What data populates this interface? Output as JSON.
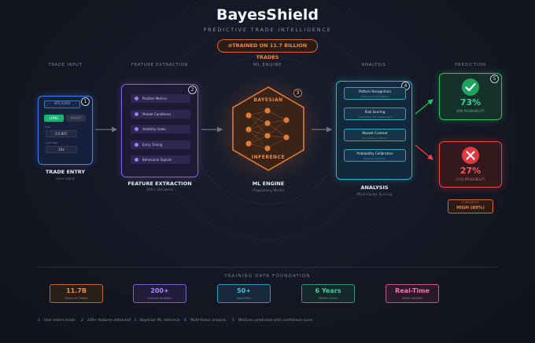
{
  "header": {
    "title": "BayesShield",
    "subtitle": "PREDICTIVE TRADE INTELLIGENCE",
    "badge": "⊚TRAINED ON 11.7 BILLION TRADES"
  },
  "stages": {
    "input": "TRADE INPUT",
    "features": "FEATURE EXTRACTION",
    "engine": "ML ENGINE",
    "analysis": "ANALYSIS",
    "prediction": "PREDICTION"
  },
  "trade": {
    "num": "1",
    "asset": "BTC/USD",
    "long": "LONG",
    "short": "SHORT",
    "size_label": "Size",
    "size": "0.5 BTC",
    "leverage_label": "Leverage",
    "leverage": "10x",
    "title": "TRADE ENTRY",
    "sub": "User Input"
  },
  "features": {
    "num": "2",
    "items": [
      "Position Metrics",
      "Market Conditions",
      "Volatility Index",
      "Entry Timing",
      "Behavioral Signals"
    ],
    "title": "FEATURE EXTRACTION",
    "sub": "200+ Variables"
  },
  "engine": {
    "num": "3",
    "top": "BAYESIAN",
    "bottom": "INFERENCE",
    "title": "ML ENGINE",
    "sub": "Proprietary Model"
  },
  "analysis": {
    "num": "4",
    "items": [
      {
        "title": "Pattern Recognition",
        "sub": "Historical trade patterns"
      },
      {
        "title": "Risk Scoring",
        "sub": "Multi-factor risk assessment"
      },
      {
        "title": "Market Context",
        "sub": "Real-time conditions"
      },
      {
        "title": "Probability Calibration",
        "sub": "Bayesian posterior"
      }
    ],
    "title": "ANALYSIS",
    "sub": "Multi-Factor Scoring"
  },
  "prediction": {
    "num": "5",
    "win_pct": "73%",
    "win_label": "WIN PROBABILITY",
    "loss_pct": "27%",
    "loss_label": "LOSS PROBABILITY",
    "confidence_label": "CONFIDENCE",
    "confidence_value": "HIGH (89%)"
  },
  "foundation": {
    "title": "TRAINING DATA FOUNDATION",
    "stats": [
      {
        "value": "11.7B",
        "label": "Historical Trades",
        "color": "#f08a3e"
      },
      {
        "value": "200+",
        "label": "Feature Variables",
        "color": "#a78bfa"
      },
      {
        "value": "50+",
        "label": "Asset Pairs",
        "color": "#38c4dc"
      },
      {
        "value": "6 Years",
        "label": "Market Cycles",
        "color": "#34d399"
      },
      {
        "value": "Real-Time",
        "label": "Model Updates",
        "color": "#f472b6"
      }
    ]
  },
  "legend": [
    {
      "n": "1",
      "text": "User enters trade"
    },
    {
      "n": "2",
      "text": "200+ features extracted"
    },
    {
      "n": "3",
      "text": "Bayesian ML inference"
    },
    {
      "n": "4",
      "text": "Multi-factor analysis"
    },
    {
      "n": "5",
      "text": "Win/Loss prediction with confidence score"
    }
  ]
}
